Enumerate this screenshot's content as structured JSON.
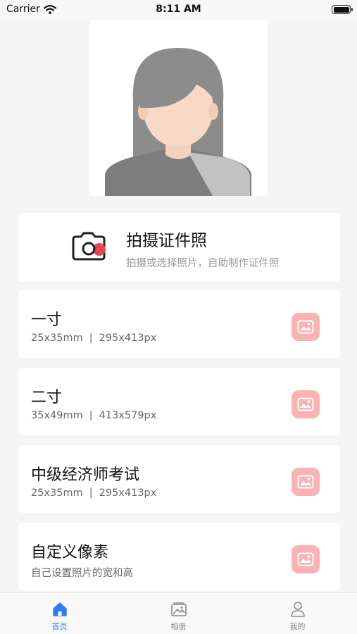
{
  "status": {
    "carrier": "Carrier",
    "time": "8:11 AM"
  },
  "portrait": {
    "icon": "woman-portrait-icon"
  },
  "capture": {
    "title": "拍摄证件照",
    "subtitle": "拍摄或选择照片，自助制作证件照",
    "icon": "camera-icon"
  },
  "sizes": [
    {
      "title": "一寸",
      "mm": "25x35mm",
      "px": "295x413px"
    },
    {
      "title": "二寸",
      "mm": "35x49mm",
      "px": "413x579px"
    },
    {
      "title": "中级经济师考试",
      "mm": "25x35mm",
      "px": "295x413px"
    },
    {
      "title": "自定义像素",
      "desc": "自己设置照片的宽和高"
    }
  ],
  "size_separator": "|",
  "tabs": [
    {
      "label": "首页",
      "icon": "home-icon",
      "active": true
    },
    {
      "label": "相册",
      "icon": "album-icon",
      "active": false
    },
    {
      "label": "我的",
      "icon": "user-icon",
      "active": false
    }
  ],
  "colors": {
    "accent": "#2f7cf6",
    "image_button": "#fbb2b2",
    "camera_red": "#e94550"
  }
}
